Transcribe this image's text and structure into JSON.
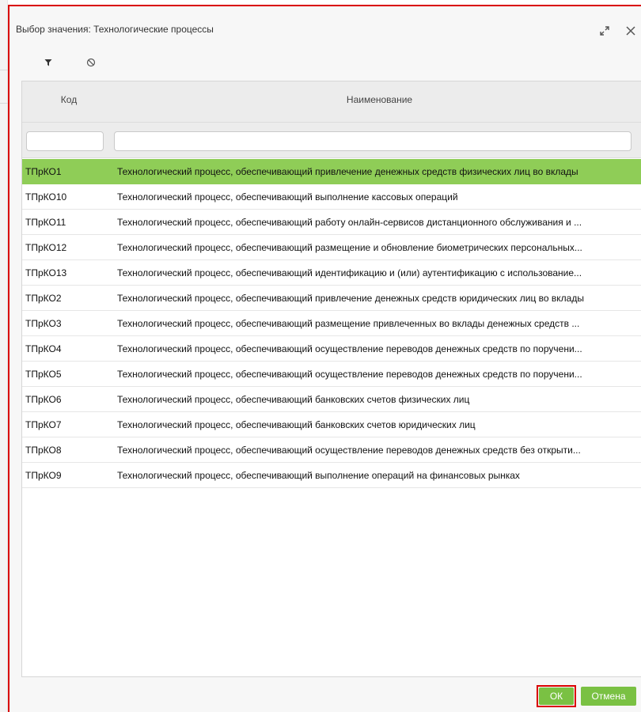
{
  "dialog": {
    "title": "Выбор значения: Технологические процессы"
  },
  "icons": {
    "expand": "expand-icon",
    "close": "close-icon",
    "filter": "filter-icon",
    "clear_filter": "clear-filter-icon"
  },
  "colors": {
    "accent": "#7ac143",
    "selected_row": "#8fcd57",
    "highlight_border": "#d90000"
  },
  "grid": {
    "columns": [
      "Код",
      "Наименование"
    ],
    "filters": {
      "code": "",
      "name": ""
    },
    "rows": [
      {
        "code": "ТПрКО1",
        "name": "Технологический процесс, обеспечивающий привлечение денежных средств физических лиц во вклады",
        "selected": true
      },
      {
        "code": "ТПрКО10",
        "name": "Технологический процесс, обеспечивающий выполнение кассовых операций"
      },
      {
        "code": "ТПрКО11",
        "name": "Технологический процесс, обеспечивающий работу онлайн-сервисов дистанционного обслуживания и ..."
      },
      {
        "code": "ТПрКО12",
        "name": "Технологический процесс, обеспечивающий размещение и обновление биометрических персональных..."
      },
      {
        "code": "ТПрКО13",
        "name": "Технологический процесс, обеспечивающий идентификацию и (или) аутентификацию с использование..."
      },
      {
        "code": "ТПрКО2",
        "name": "Технологический процесс, обеспечивающий привлечение денежных средств юридических лиц во вклады"
      },
      {
        "code": "ТПрКО3",
        "name": "Технологический процесс, обеспечивающий размещение привлеченных во вклады денежных средств ..."
      },
      {
        "code": "ТПрКО4",
        "name": "Технологический процесс, обеспечивающий осуществление переводов денежных средств по поручени..."
      },
      {
        "code": "ТПрКО5",
        "name": "Технологический процесс, обеспечивающий осуществление переводов денежных средств по поручени..."
      },
      {
        "code": "ТПрКО6",
        "name": "Технологический процесс, обеспечивающий банковских счетов физических лиц"
      },
      {
        "code": "ТПрКО7",
        "name": "Технологический процесс, обеспечивающий банковских счетов юридических лиц"
      },
      {
        "code": "ТПрКО8",
        "name": "Технологический процесс, обеспечивающий осуществление переводов денежных средств без открыти..."
      },
      {
        "code": "ТПрКО9",
        "name": "Технологический процесс, обеспечивающий выполнение операций на финансовых рынках"
      }
    ]
  },
  "footer": {
    "ok_label": "ОК",
    "cancel_label": "Отмена"
  }
}
